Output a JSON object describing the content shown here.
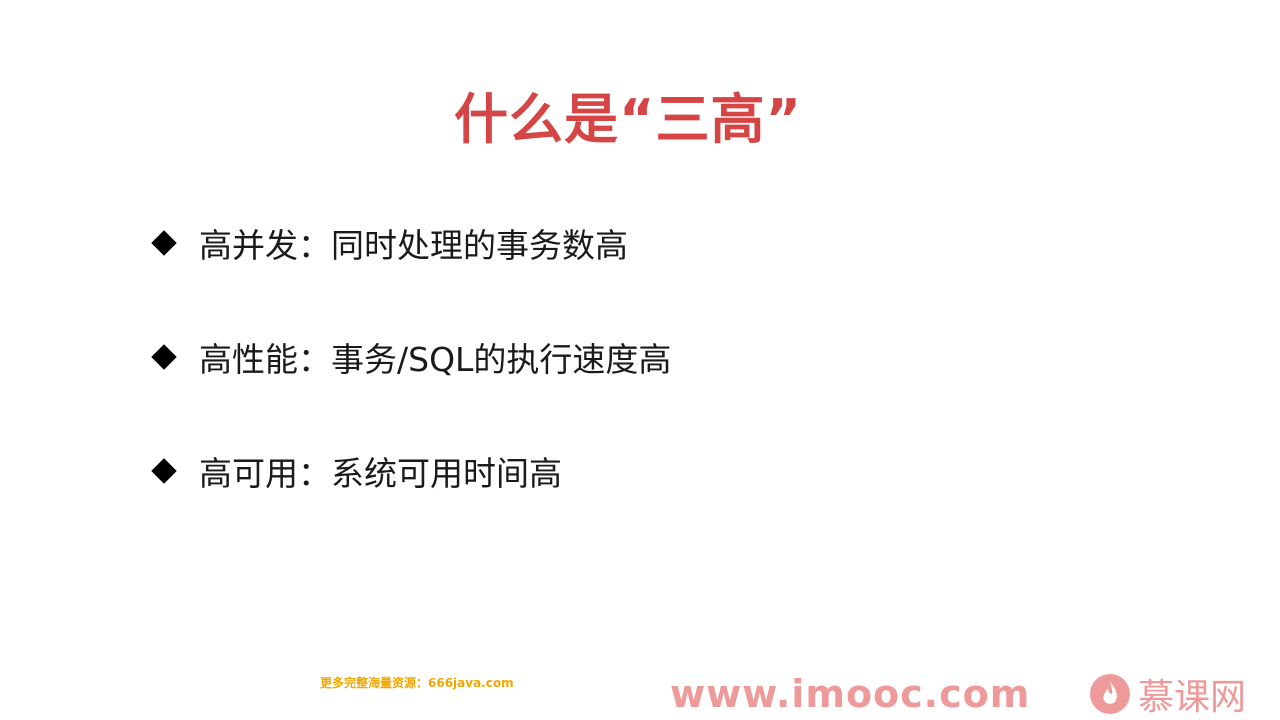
{
  "slide": {
    "title": "什么是“三高”",
    "bullets": [
      "高并发：同时处理的事务数高",
      "高性能：事务/SQL的执行速度高",
      "高可用：系统可用时间高"
    ]
  },
  "watermarks": {
    "resource_note": "更多完整海量资源：666java.com",
    "site_url": "www.imooc.com",
    "brand_name": "慕课网",
    "brand_logo_icon": "flame-logo-icon"
  },
  "colors": {
    "title": "#d64545",
    "bullet_text": "#1a1a1a",
    "watermark_url": "#ef9a9a",
    "resource_note": "#f0a800"
  }
}
